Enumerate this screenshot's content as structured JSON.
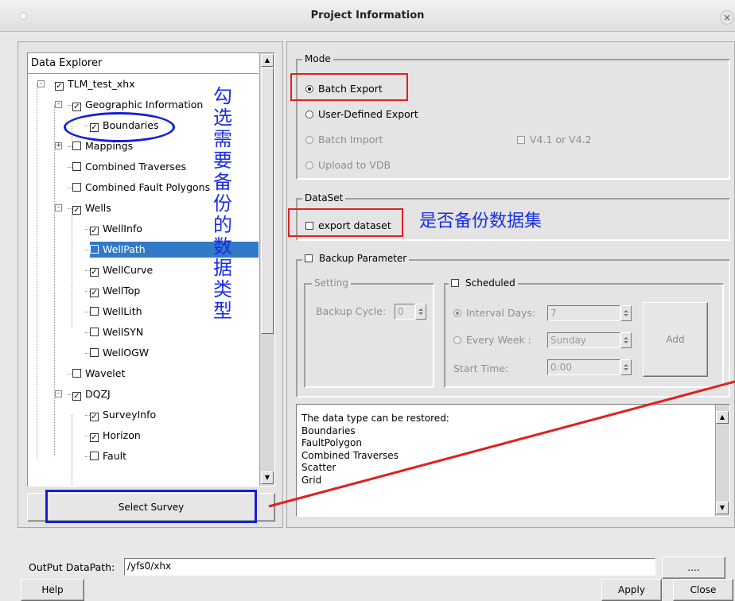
{
  "window": {
    "title": "Project Information"
  },
  "data_explorer": {
    "header": "Data Explorer",
    "items": [
      {
        "label": "TLM_test_xhx",
        "checked": true,
        "level": 0,
        "expander": "-"
      },
      {
        "label": "Geographic Information",
        "checked": true,
        "level": 1,
        "expander": "-"
      },
      {
        "label": "Boundaries",
        "checked": true,
        "level": 2
      },
      {
        "label": "Mappings",
        "checked": false,
        "level": 1,
        "expander": "+"
      },
      {
        "label": "Combined Traverses",
        "checked": false,
        "level": 1
      },
      {
        "label": "Combined Fault Polygons",
        "checked": false,
        "level": 1
      },
      {
        "label": "Wells",
        "checked": true,
        "level": 1,
        "expander": "-"
      },
      {
        "label": "WellInfo",
        "checked": true,
        "level": 2
      },
      {
        "label": "WellPath",
        "checked": false,
        "level": 2,
        "selected": true
      },
      {
        "label": "WellCurve",
        "checked": true,
        "level": 2
      },
      {
        "label": "WellTop",
        "checked": true,
        "level": 2
      },
      {
        "label": "WellLith",
        "checked": false,
        "level": 2
      },
      {
        "label": "WellSYN",
        "checked": false,
        "level": 2
      },
      {
        "label": "WellOGW",
        "checked": false,
        "level": 2
      },
      {
        "label": "Wavelet",
        "checked": false,
        "level": 1
      },
      {
        "label": "DQZJ",
        "checked": true,
        "level": 1,
        "expander": "-"
      },
      {
        "label": "SurveyInfo",
        "checked": true,
        "level": 2
      },
      {
        "label": "Horizon",
        "checked": true,
        "level": 2
      },
      {
        "label": "Fault",
        "checked": false,
        "level": 2
      }
    ],
    "select_survey_label": "Select Survey"
  },
  "mode": {
    "title": "Mode",
    "batch_export": "Batch Export",
    "user_defined_export": "User-Defined Export",
    "batch_import": "Batch Import",
    "version_check": "V4.1 or V4.2",
    "upload_vdb": "Upload to VDB",
    "selected": "Batch Export"
  },
  "dataset": {
    "title": "DataSet",
    "export_dataset": "export dataset",
    "export_dataset_checked": false
  },
  "backup": {
    "title": "Backup Parameter",
    "checked": false,
    "setting_title": "Setting",
    "backup_cycle_label": "Backup Cycle:",
    "backup_cycle_value": "0",
    "scheduled_title": "Scheduled",
    "scheduled_checked": false,
    "interval_days_label": "Interval Days:",
    "interval_days_value": "7",
    "every_week_label": "Every Week :",
    "every_week_value": "Sunday",
    "start_time_label": "Start Time:",
    "start_time_value": "0:00",
    "add_label": "Add"
  },
  "restore_info": {
    "lines": [
      "The data type can be restored:",
      "Boundaries",
      "FaultPolygon",
      "Combined Traverses",
      "Scatter",
      "Grid"
    ]
  },
  "output": {
    "label": "OutPut DataPath:",
    "value": "/yfs0/xhx",
    "browse_label": "...."
  },
  "footer": {
    "help_label": "Help",
    "apply_label": "Apply",
    "close_label": "Close"
  },
  "annotations": {
    "select_types_note": "勾选需要备份的数据类型",
    "backup_dataset_note": "是否备份数据集",
    "red": "#e02020",
    "blue": "#1420d6"
  },
  "colors": {
    "selection": "#3279c8",
    "background": "#e4e4e4"
  }
}
